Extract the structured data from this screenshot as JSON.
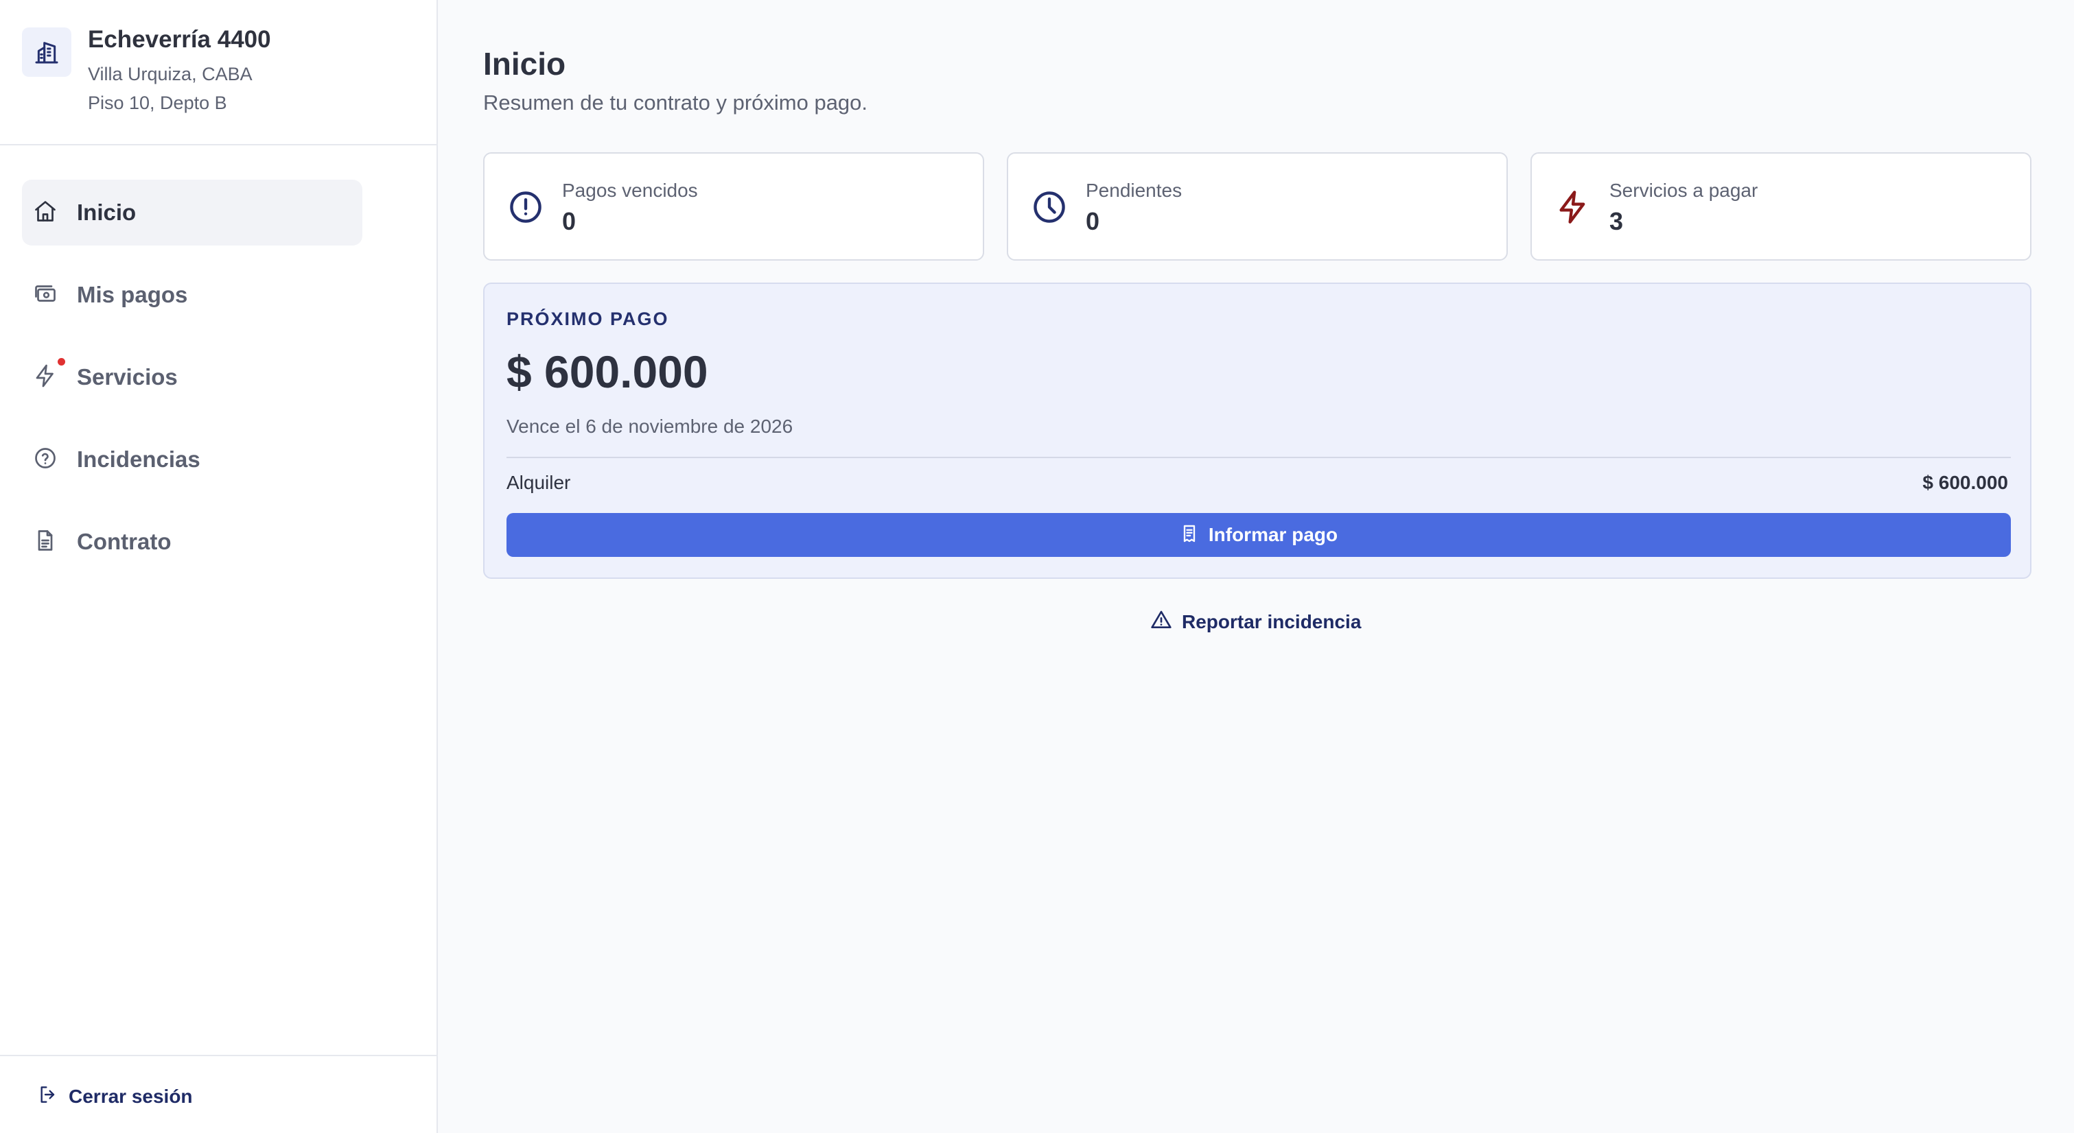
{
  "property": {
    "title": "Echeverría 4400",
    "line1": "Villa Urquiza, CABA",
    "line2": "Piso 10, Depto B",
    "icon": "building-icon"
  },
  "nav": {
    "items": [
      {
        "label": "Inicio",
        "icon": "home-icon",
        "active": true
      },
      {
        "label": "Mis pagos",
        "icon": "money-icon",
        "active": false
      },
      {
        "label": "Servicios",
        "icon": "bolt-icon",
        "active": false,
        "notification": true
      },
      {
        "label": "Incidencias",
        "icon": "question-circle-icon",
        "active": false
      },
      {
        "label": "Contrato",
        "icon": "document-icon",
        "active": false
      }
    ]
  },
  "logout": {
    "label": "Cerrar sesión",
    "icon": "logout-icon"
  },
  "page": {
    "title": "Inicio",
    "subtitle": "Resumen de tu contrato y próximo pago."
  },
  "stats": [
    {
      "label": "Pagos vencidos",
      "value": "0",
      "icon": "alert-circle-icon",
      "color": "#24306e"
    },
    {
      "label": "Pendientes",
      "value": "0",
      "icon": "clock-icon",
      "color": "#24306e"
    },
    {
      "label": "Servicios a pagar",
      "value": "3",
      "icon": "bolt-icon",
      "color": "#8b1a1a"
    }
  ],
  "next_payment": {
    "label": "PRÓXIMO PAGO",
    "amount": "$ 600.000",
    "due": "Vence el 6 de noviembre de 2026",
    "line_label": "Alquiler",
    "line_value": "$ 600.000",
    "button_label": "Informar pago",
    "button_icon": "receipt-icon"
  },
  "report": {
    "label": "Reportar incidencia",
    "icon": "warning-icon"
  },
  "colors": {
    "accent": "#4a6be0",
    "navy": "#1f2b66",
    "notification": "#e03131"
  }
}
